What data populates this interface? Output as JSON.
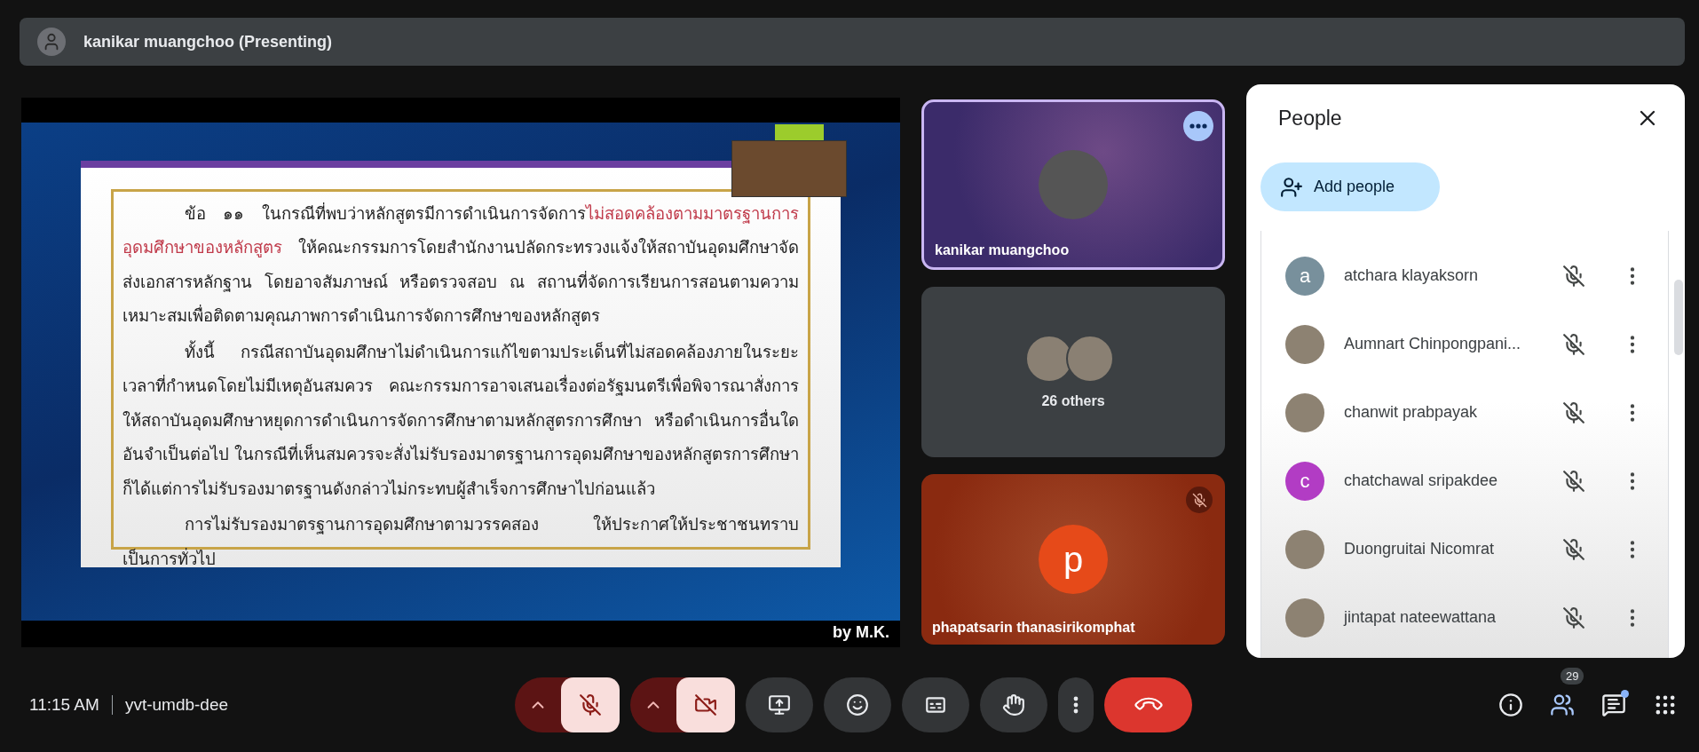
{
  "top_bar": {
    "presenter": "kanikar muangchoo (Presenting)"
  },
  "slide": {
    "paragraphs": [
      {
        "segments": [
          {
            "text": "ข้อ ๑๑ ในกรณีที่พบว่าหลักสูตรมีการดำเนินการจัดการ",
            "highlighted": false
          },
          {
            "text": "ไม่สอดคล้องตามมาตรฐานการอุดมศึกษาของหลักสูตร",
            "highlighted": true
          },
          {
            "text": " ให้คณะกรรมการโดยสำนักงานปลัดกระทรวงแจ้งให้สถาบันอุดมศึกษาจัดส่งเอกสารหลักฐาน โดยอาจสัมภาษณ์ หรือตรวจสอบ ณ สถานที่จัดการเรียนการสอนตามความเหมาะสมเพื่อติดตามคุณภาพการดำเนินการจัดการศึกษาของหลักสูตร",
            "highlighted": false
          }
        ]
      },
      {
        "segments": [
          {
            "text": "ทั้งนี้ กรณีสถาบันอุดมศึกษาไม่ดำเนินการแก้ไขตามประเด็นที่ไม่สอดคล้องภายในระยะเวลาที่กำหนดโดยไม่มีเหตุอันสมควร คณะกรรมการอาจเสนอเรื่องต่อรัฐมนตรีเพื่อพิจารณาสั่งการให้สถาบันอุดมศึกษาหยุดการดำเนินการจัดการศึกษาตามหลักสูตรการศึกษา หรือดำเนินการอื่นใดอันจำเป็นต่อไป ในกรณีที่เห็นสมควรจะสั่งไม่รับรองมาตรฐานการอุดมศึกษาของหลักสูตรการศึกษาก็ได้แต่การไม่รับรองมาตรฐานดังกล่าวไม่กระทบผู้สำเร็จการศึกษาไปก่อนแล้ว",
            "highlighted": false
          }
        ]
      },
      {
        "segments": [
          {
            "text": "การไม่รับรองมาตรฐานการอุดมศึกษาตามวรรคสอง ให้ประกาศให้ประชาชนทราบเป็นการทั่วไป",
            "highlighted": false
          }
        ]
      }
    ],
    "credit": "by M.K."
  },
  "tiles": [
    {
      "kind": "person",
      "name": "kanikar muangchoo",
      "highlighted": true,
      "muted": false
    },
    {
      "kind": "group",
      "label": "26 others"
    },
    {
      "kind": "person",
      "name": "phapatsarin thanasirikomphat",
      "highlighted": false,
      "muted": true,
      "initial": "p"
    }
  ],
  "people_panel": {
    "title": "People",
    "add_button": "Add people",
    "participants": [
      {
        "name": "atchara klayaksorn",
        "initial": "a",
        "color": "#78909c",
        "muted": true
      },
      {
        "name": "Aumnart Chinpongpani...",
        "muted": true
      },
      {
        "name": "chanwit prabpayak",
        "muted": true
      },
      {
        "name": "chatchawal sripakdee",
        "initial": "c",
        "color": "#b23cc4",
        "muted": true
      },
      {
        "name": "Duongruitai Nicomrat",
        "muted": true
      },
      {
        "name": "jintapat nateewattana",
        "muted": true
      }
    ]
  },
  "bottom_bar": {
    "time": "11:15 AM",
    "meeting_code": "yvt-umdb-dee",
    "mic_on": false,
    "camera_on": false,
    "people_count": "29",
    "chat_unread": true
  }
}
